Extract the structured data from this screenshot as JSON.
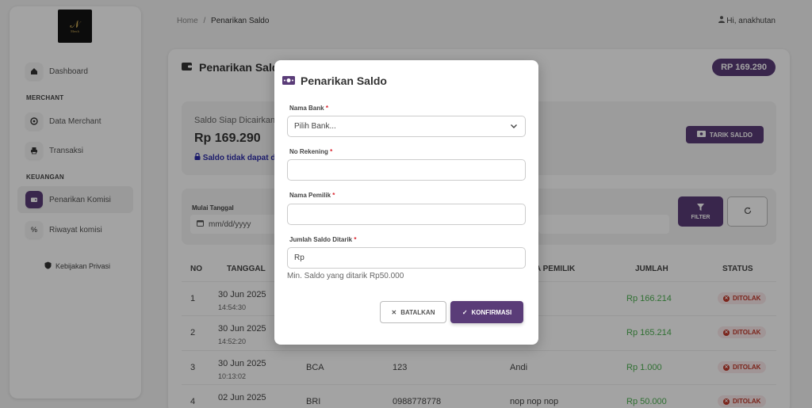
{
  "logo": {
    "glyph": "𝒩",
    "text": "Merch"
  },
  "sidebar": {
    "items": [
      {
        "label": "Dashboard",
        "icon": "home-icon"
      },
      {
        "label": "Data Merchant",
        "icon": "info-icon"
      },
      {
        "label": "Transaksi",
        "icon": "printer-icon"
      },
      {
        "label": "Penarikan Komisi",
        "icon": "wallet-icon"
      },
      {
        "label": "Riwayat komisi",
        "icon": "percent-icon"
      }
    ],
    "sections": [
      "MERCHANT",
      "KEUANGAN"
    ],
    "privacy": "Kebijakan Privasi"
  },
  "breadcrumb": {
    "home": "Home",
    "sep": "/",
    "current": "Penarikan Saldo"
  },
  "user": {
    "greeting": "Hi, anakhutan"
  },
  "page": {
    "title": "Penarikan Saldo",
    "balance_badge": "RP 169.290",
    "saldo_label": "Saldo Siap Dicairkan",
    "saldo_value": "Rp 169.290",
    "saldo_note": "Saldo tidak dapat di",
    "tarik_button": "TARIK SALDO"
  },
  "filter": {
    "start_label": "Mulai Tanggal",
    "start_placeholder": "mm/dd/yyyy",
    "filter_button": "FILTER"
  },
  "table": {
    "headers": [
      "NO",
      "TANGGAL",
      "A PEMILIK",
      "JUMLAH",
      "STATUS"
    ],
    "rows": [
      {
        "no": "1",
        "date": "30 Jun 2025",
        "time": "14:54:30",
        "bank": "",
        "rek": "",
        "pemilik": "",
        "jumlah": "Rp 166.214",
        "status": "DITOLAK"
      },
      {
        "no": "2",
        "date": "30 Jun 2025",
        "time": "14:52:20",
        "bank": "",
        "rek": "",
        "pemilik": "",
        "jumlah": "Rp 165.214",
        "status": "DITOLAK"
      },
      {
        "no": "3",
        "date": "30 Jun 2025",
        "time": "10:13:02",
        "bank": "BCA",
        "rek": "123",
        "pemilik": "Andi",
        "jumlah": "Rp 1.000",
        "status": "DITOLAK"
      },
      {
        "no": "4",
        "date": "02 Jun 2025",
        "time": "",
        "bank": "BRI",
        "rek": "0988778778",
        "pemilik": "nop nop nop",
        "jumlah": "Rp 50.000",
        "status": "DITOLAK"
      }
    ]
  },
  "modal": {
    "title": "Penarikan Saldo",
    "bank_label": "Nama Bank",
    "bank_placeholder": "Pilih Bank...",
    "rek_label": "No Rekening",
    "owner_label": "Nama Pemilik",
    "amount_label": "Jumlah Saldo Ditarik",
    "amount_prefix": "Rp",
    "required_mark": "*",
    "hint": "Min. Saldo yang ditarik Rp50.000",
    "cancel_label": "BATALKAN",
    "confirm_label": "KONFIRMASI"
  },
  "colors": {
    "accent": "#5a3c78",
    "success": "#4caf50",
    "danger": "#c0392b"
  }
}
